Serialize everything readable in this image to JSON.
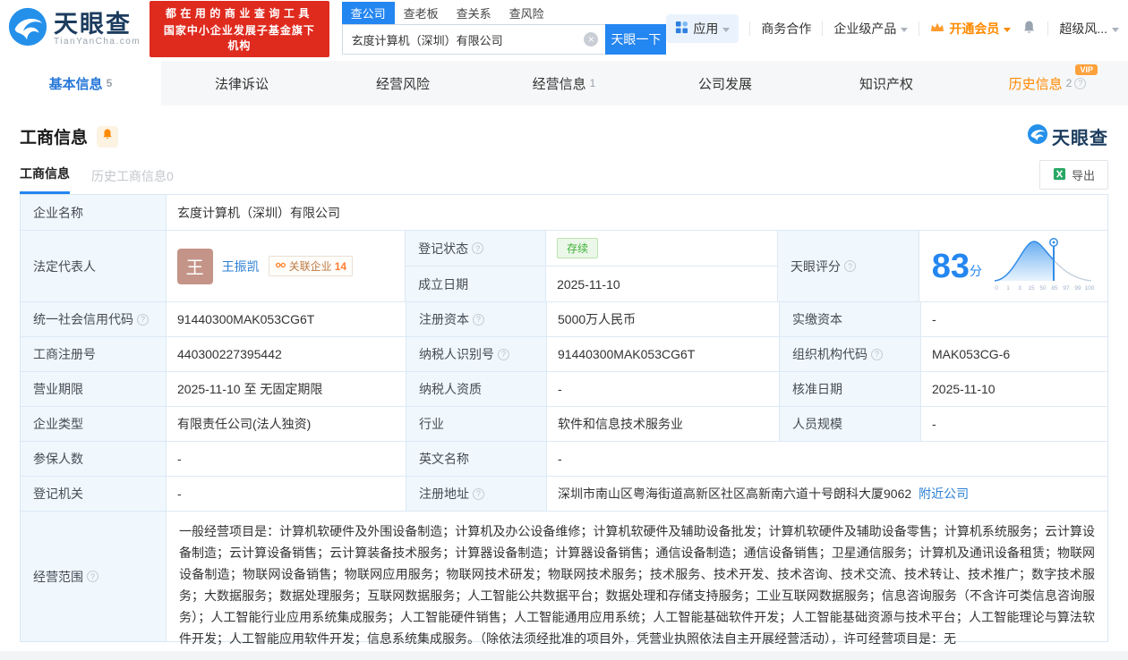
{
  "colors": {
    "primary_blue": "#2486f0",
    "link_blue": "#2b7fd4",
    "banner_red": "#df2a1e",
    "vip_orange": "#ff8a00",
    "status_green": "#3eb036"
  },
  "header": {
    "brand": "天眼查",
    "brand_domain": "TianYanCha.com",
    "banner_line1": "都在用的商业查询工具",
    "banner_line2": "国家中小企业发展子基金旗下机构",
    "search_tabs": [
      {
        "label": "查公司"
      },
      {
        "label": "查老板"
      },
      {
        "label": "查关系"
      },
      {
        "label": "查风险"
      }
    ],
    "search_value": "玄度计算机（深圳）有限公司",
    "search_button": "天眼一下",
    "nav_apps": "应用",
    "nav_business": "商务合作",
    "nav_enterprise": "企业级产品",
    "nav_vip": "开通会员",
    "nav_risk": "超级风..."
  },
  "tabs": [
    {
      "label": "基本信息",
      "count": "5"
    },
    {
      "label": "法律诉讼"
    },
    {
      "label": "经营风险"
    },
    {
      "label": "经营信息",
      "count": "1"
    },
    {
      "label": "公司发展"
    },
    {
      "label": "知识产权"
    },
    {
      "label": "历史信息",
      "count": "2",
      "vip_badge": "VIP"
    }
  ],
  "section": {
    "title": "工商信息",
    "watermark_brand": "天眼查",
    "subtab_active": "工商信息",
    "subtab_history": "历史工商信息0",
    "export_label": "导出"
  },
  "table": {
    "company_name": {
      "label": "企业名称",
      "value": "玄度计算机（深圳）有限公司"
    },
    "legal_rep": {
      "label": "法定代表人",
      "avatar": "王",
      "name": "王振凯",
      "badge": "关联企业",
      "badge_count": "14"
    },
    "reg_status": {
      "label": "登记状态",
      "value": "存续"
    },
    "establish_date": {
      "label": "成立日期",
      "value": "2025-11-10"
    },
    "score": {
      "label": "天眼评分",
      "value": "83",
      "unit": "分",
      "axis": [
        "0",
        "1",
        "3",
        "15",
        "50",
        "85",
        "97",
        "99",
        "100"
      ]
    },
    "credit_code": {
      "label": "统一社会信用代码",
      "value": "91440300MAK053CG6T"
    },
    "reg_capital": {
      "label": "注册资本",
      "value": "5000万人民币"
    },
    "paid_capital": {
      "label": "实缴资本",
      "value": "-"
    },
    "reg_number": {
      "label": "工商注册号",
      "value": "440300227395442"
    },
    "taxpayer_id": {
      "label": "纳税人识别号",
      "value": "91440300MAK053CG6T"
    },
    "org_code": {
      "label": "组织机构代码",
      "value": "MAK053CG-6"
    },
    "business_term": {
      "label": "营业期限",
      "value": "2025-11-10 至 无固定期限"
    },
    "taxpayer_quality": {
      "label": "纳税人资质",
      "value": "-"
    },
    "approval_date": {
      "label": "核准日期",
      "value": "2025-11-10"
    },
    "company_type": {
      "label": "企业类型",
      "value": "有限责任公司(法人独资)"
    },
    "industry": {
      "label": "行业",
      "value": "软件和信息技术服务业"
    },
    "staff_size": {
      "label": "人员规模",
      "value": "-"
    },
    "insured_num": {
      "label": "参保人数",
      "value": "-"
    },
    "english_name": {
      "label": "英文名称",
      "value": "-"
    },
    "reg_authority": {
      "label": "登记机关",
      "value": "-"
    },
    "reg_address": {
      "label": "注册地址",
      "value": "深圳市南山区粤海街道高新区社区高新南六道十号朗科大厦9062",
      "link": "附近公司"
    },
    "business_scope": {
      "label": "经营范围",
      "value": "一般经营项目是：计算机软硬件及外围设备制造；计算机及办公设备维修；计算机软硬件及辅助设备批发；计算机软硬件及辅助设备零售；计算机系统服务；云计算设备制造；云计算设备销售；云计算装备技术服务；计算器设备制造；计算器设备销售；通信设备制造；通信设备销售；卫星通信服务；计算机及通讯设备租赁；物联网设备制造；物联网设备销售；物联网应用服务；物联网技术研发；物联网技术服务；技术服务、技术开发、技术咨询、技术交流、技术转让、技术推广；数字技术服务；大数据服务；数据处理服务；互联网数据服务；人工智能公共数据平台；数据处理和存储支持服务；工业互联网数据服务；信息咨询服务（不含许可类信息咨询服务）；人工智能行业应用系统集成服务；人工智能硬件销售；人工智能通用应用系统；人工智能基础软件开发；人工智能基础资源与技术平台；人工智能理论与算法软件开发；人工智能应用软件开发；信息系统集成服务。（除依法须经批准的项目外，凭营业执照依法自主开展经营活动），许可经营项目是：无"
    }
  }
}
